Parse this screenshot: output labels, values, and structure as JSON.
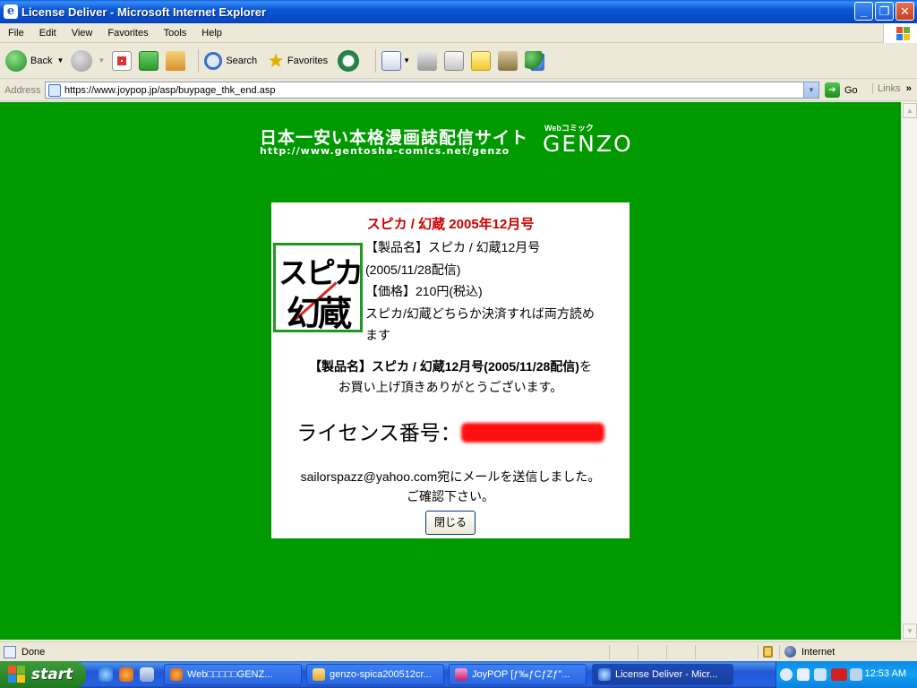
{
  "window": {
    "title": "License Deliver - Microsoft Internet Explorer",
    "app_icon": "e",
    "controls": {
      "minimize": "_",
      "maximize": "❐",
      "close": "✕"
    }
  },
  "menu": [
    "File",
    "Edit",
    "View",
    "Favorites",
    "Tools",
    "Help"
  ],
  "toolbar": {
    "back_label": "Back",
    "search_label": "Search",
    "favorites_label": "Favorites"
  },
  "address": {
    "label": "Address",
    "url": "https://www.joypop.jp/asp/buypage_thk_end.asp",
    "go_label": "Go",
    "links_label": "Links",
    "links_chevron": "»"
  },
  "page": {
    "banner": {
      "jp_title": "日本一安い本格漫画誌配信サイト",
      "site_url": "http://www.gentosha-comics.net/genzo",
      "logo_small": "Webコミック",
      "logo": "GENZO"
    },
    "card": {
      "heading": "スピカ / 幻蔵 2005年12月号",
      "thumb_line1": "スピカ",
      "thumb_line2": "幻蔵",
      "product_line1": "【製品名】スピカ / 幻蔵12月号",
      "product_line2": "(2005/11/28配信)",
      "price": "【価格】210円(税込)",
      "note_line1": "スピカ/幻蔵どちらか決済すれば両方読め",
      "note_line2": "ます",
      "thanks_bold": "【製品名】スピカ / 幻蔵12月号(2005/11/28配信)",
      "thanks_rest1": "を",
      "thanks_line2": "お買い上げ頂きありがとうございます。",
      "license_label": "ライセンス番号：",
      "mail_line1": "sailorspazz@yahoo.com宛にメールを送信しました。",
      "mail_line2": "ご確認下さい。",
      "close_button": "閉じる"
    }
  },
  "status": {
    "text": "Done",
    "zone": "Internet"
  },
  "taskbar": {
    "start_label": "start",
    "tasks": [
      {
        "label": "Web□□□□□GENZ..."
      },
      {
        "label": "genzo-spica200512cr..."
      },
      {
        "label": "JoyPOP [ƒ‰ƒCƒZƒ\"..."
      },
      {
        "label": "License Deliver - Micr..."
      }
    ],
    "clock": "12:53 AM"
  },
  "colors": {
    "page_background": "#009900",
    "heading_red": "#cc0000",
    "redaction": "#ff1010"
  }
}
